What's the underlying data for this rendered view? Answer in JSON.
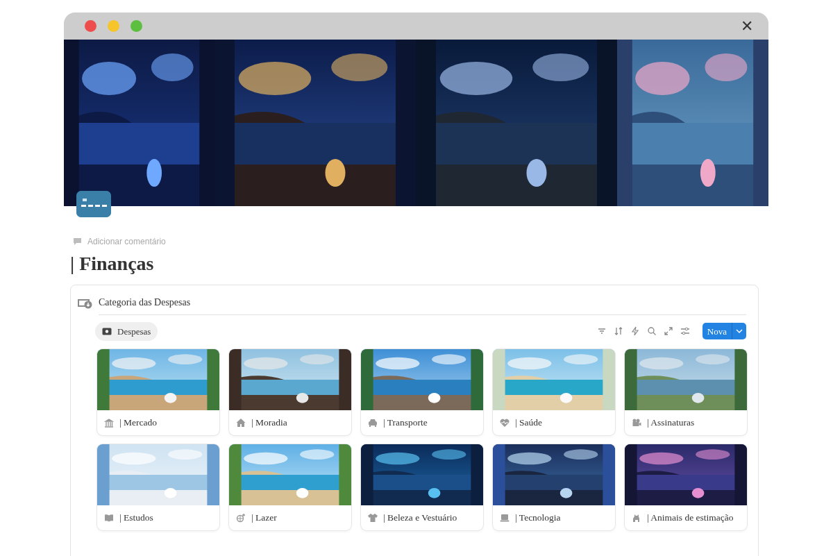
{
  "window": {
    "close": "✕"
  },
  "comment": {
    "label": "Adicionar comentário"
  },
  "title": "| Finanças",
  "database": {
    "title": "Categoria das Despesas",
    "tabs": [
      {
        "label": "Despesas",
        "selected": true
      }
    ],
    "new_button": "Nova",
    "cards": [
      {
        "label": "| Mercado"
      },
      {
        "label": "| Moradia"
      },
      {
        "label": "| Transporte"
      },
      {
        "label": "| Saúde"
      },
      {
        "label": "| Assinaturas"
      },
      {
        "label": "| Estudos"
      },
      {
        "label": "| Lazer"
      },
      {
        "label": "| Beleza e Vestuário"
      },
      {
        "label": "| Tecnologia"
      },
      {
        "label": "| Animais de estimação"
      }
    ]
  }
}
